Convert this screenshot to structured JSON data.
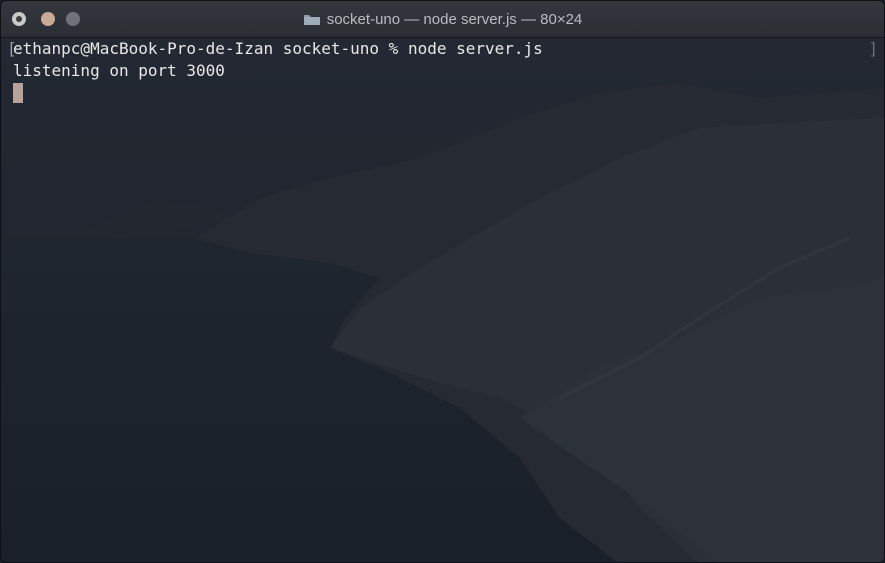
{
  "window": {
    "title": "socket-uno — node server.js — 80×24"
  },
  "icons": {
    "close": "close-icon",
    "minimize": "minimize-icon",
    "zoom": "zoom-icon",
    "folder": "folder-icon"
  },
  "colors": {
    "titlebar": "#2f3237",
    "terminal_text": "#e8e8e8",
    "cursor": "#b7a39a",
    "background": "#1f232b"
  },
  "terminal": {
    "lines": [
      "ethanpc@MacBook-Pro-de-Izan socket-uno % node server.js",
      "listening on port 3000"
    ]
  }
}
